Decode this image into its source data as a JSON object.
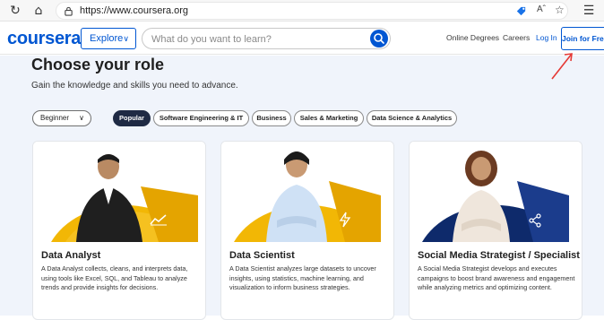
{
  "browser": {
    "url": "https://www.coursera.org",
    "icons": [
      "refresh-icon",
      "home-icon",
      "lock-icon",
      "tag-icon",
      "read-aloud-icon",
      "favorite-icon",
      "collections-icon"
    ]
  },
  "header": {
    "logo": "coursera",
    "explore_label": "Explore",
    "search_placeholder": "What do you want to learn?",
    "nav": {
      "online_degrees": "Online Degrees",
      "careers": "Careers",
      "log_in": "Log In",
      "join": "Join for Free"
    }
  },
  "main": {
    "heading": "Choose your role",
    "subheading": "Gain the knowledge and skills you need to advance.",
    "level_filter": "Beginner",
    "chips": [
      {
        "label": "Popular",
        "active": true
      },
      {
        "label": "Software Engineering & IT",
        "active": false
      },
      {
        "label": "Business",
        "active": false
      },
      {
        "label": "Sales & Marketing",
        "active": false
      },
      {
        "label": "Data Science & Analytics",
        "active": false
      }
    ],
    "cards": [
      {
        "title": "Data Analyst",
        "description": "A Data Analyst collects, cleans, and interprets data, using tools like Excel, SQL, and Tableau to analyze trends and provide insights for decisions.",
        "icon": "chart-icon"
      },
      {
        "title": "Data Scientist",
        "description": "A Data Scientist analyzes large datasets to uncover insights, using statistics, machine learning, and visualization to inform business strategies.",
        "icon": "lightning-icon"
      },
      {
        "title": "Social Media Strategist / Specialist",
        "description": "A Social Media Strategist develops and executes campaigns to boost brand awareness and engagement while analyzing metrics and optimizing content.",
        "icon": "share-icon"
      }
    ]
  },
  "colors": {
    "brand": "#0056d2",
    "annotation": "#e53935",
    "active_chip": "#1f2a44",
    "accent_yellow": "#f2b705",
    "accent_navy": "#0e2a6b"
  }
}
